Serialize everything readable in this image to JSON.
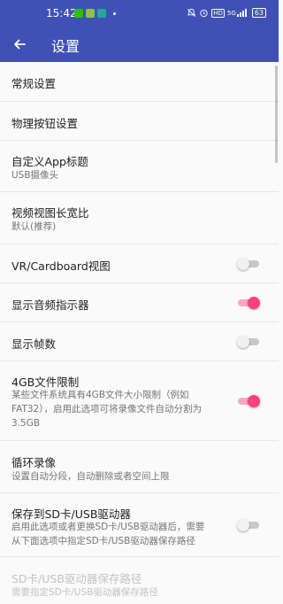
{
  "status_bar": {
    "time": "15:42",
    "notification_icons": [
      "wechat-icon",
      "check-app-icon",
      "message-app-icon"
    ],
    "system_icons": [
      "mute-bell-icon",
      "alarm-icon",
      "hd-icon",
      "5g-signal-icon"
    ],
    "hd_label": "HD",
    "network_label": "5G",
    "battery": "63"
  },
  "app_bar": {
    "title": "设置",
    "color": "#3f51b5"
  },
  "settings": [
    {
      "title": "常规设置"
    },
    {
      "title": "物理按钮设置"
    },
    {
      "title": "自定义App标题",
      "subtitle": "USB摄像头"
    },
    {
      "title": "视频视图长宽比",
      "subtitle": "默认(推荐)"
    },
    {
      "title": "VR/Cardboard视图",
      "toggle": false
    },
    {
      "title": "显示音频指示器",
      "toggle": true
    },
    {
      "title": "显示帧数",
      "toggle": false
    },
    {
      "title": "4GB文件限制",
      "subtitle": "某些文件系统具有4GB文件大小限制（例如FAT32），启用此选项可将录像文件自动分割为3.5GB",
      "subtitle_lines": [
        "某些文件系统具有4GB文件大小限制（例如",
        "FAT32），启用此选项可将录像文件自动分割为",
        "3.5GB"
      ],
      "toggle": true
    },
    {
      "title": "循环录像",
      "subtitle": "设置自动分段，自动删除或者空间上限"
    },
    {
      "title": "保存到SD卡/USB驱动器",
      "subtitle": "启用此选项或者更换SD卡/USB驱动器后，需要从下面选项中指定SD卡/USB驱动器保存路径",
      "subtitle_lines": [
        "启用此选项或者更换SD卡/USB驱动器后，需要",
        "从下面选项中指定SD卡/USB驱动器保存路径"
      ],
      "toggle": false
    },
    {
      "title": "SD卡/USB驱动器保存路径",
      "subtitle": "需要指定SD卡/USB驱动器保存路径",
      "disabled": true
    }
  ],
  "colors": {
    "toggle_on_thumb": "#ff4081",
    "toggle_on_track": "#f8a9c1",
    "toggle_off_track": "#c8c8c8"
  }
}
